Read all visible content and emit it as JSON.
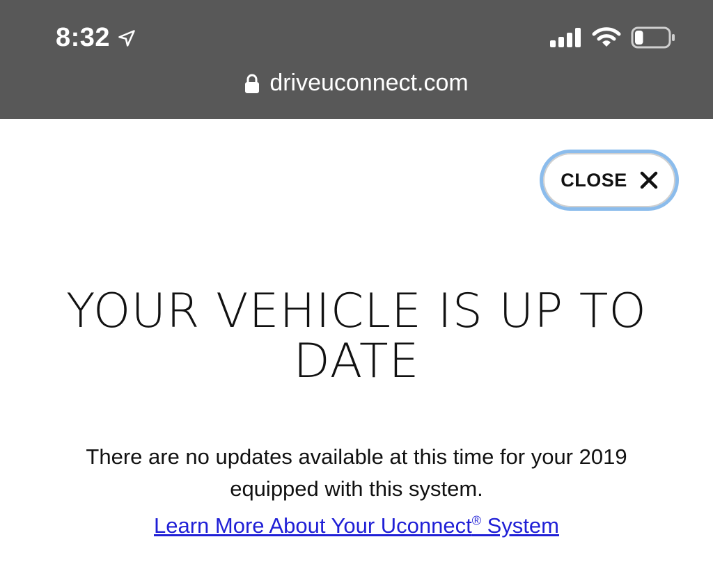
{
  "status_bar": {
    "time": "8:32",
    "location_icon": "location-arrow-icon",
    "signal_icon": "cellular-signal-icon",
    "wifi_icon": "wifi-icon",
    "battery_icon": "battery-icon",
    "battery_level": 0.25
  },
  "address_bar": {
    "lock_icon": "lock-icon",
    "domain": "driveuconnect.com"
  },
  "dialog": {
    "close_label": "CLOSE",
    "close_icon": "close-icon",
    "title": "YOUR VEHICLE IS UP TO DATE",
    "message": "There are no updates available at this time for your 2019 equipped with this system.",
    "link_text_part1": "Learn More About Your Uconnect",
    "link_reg_mark": "®",
    "link_text_part2": " System"
  },
  "colors": {
    "topbar_bg": "#585858",
    "close_border": "#8bbcec",
    "link": "#1f1fd6"
  }
}
